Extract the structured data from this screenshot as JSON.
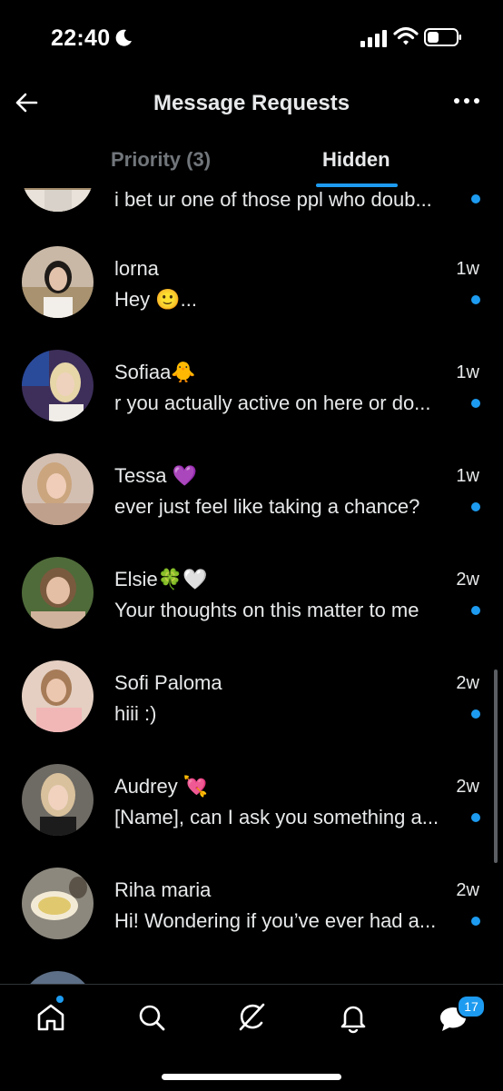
{
  "status_bar": {
    "time": "22:40"
  },
  "header": {
    "title": "Message Requests"
  },
  "tabs": [
    {
      "label": "Priority (3)",
      "active": false
    },
    {
      "label": "Hidden",
      "active": true
    }
  ],
  "conversations": [
    {
      "name": "",
      "preview": "i bet ur one of those ppl who doub...",
      "time": "",
      "unread": true,
      "avatar_bg": "#a0896a"
    },
    {
      "name": "lorna",
      "preview": "Hey 🙂...",
      "time": "1w",
      "unread": true,
      "avatar_bg": "#b39a86"
    },
    {
      "name": "Sofiaa🐥",
      "preview": "r you actually active on here or do...",
      "time": "1w",
      "unread": true,
      "avatar_bg": "#5a4a72"
    },
    {
      "name": "Tessa 💜",
      "preview": "ever just feel like taking a chance?",
      "time": "1w",
      "unread": true,
      "avatar_bg": "#c4a493"
    },
    {
      "name": "Elsie🍀🤍",
      "preview": "Your thoughts on this matter to me",
      "time": "2w",
      "unread": true,
      "avatar_bg": "#6e8a52"
    },
    {
      "name": "Sofi Paloma",
      "preview": "hiii :)",
      "time": "2w",
      "unread": true,
      "avatar_bg": "#d1b3a2"
    },
    {
      "name": "Audrey 💘",
      "preview": "[Name], can I ask you something a...",
      "time": "2w",
      "unread": true,
      "avatar_bg": "#8b8076"
    },
    {
      "name": "Riha maria",
      "preview": "Hi! Wondering if you’ve ever had a...",
      "time": "2w",
      "unread": true,
      "avatar_bg": "#7d7a6e"
    }
  ],
  "nav": {
    "messages_badge": "17",
    "items": [
      "home-icon",
      "search-icon",
      "grok-icon",
      "notifications-icon",
      "messages-icon"
    ]
  },
  "colors": {
    "accent": "#1d9bf0",
    "background": "#000000",
    "muted": "#71767b"
  }
}
